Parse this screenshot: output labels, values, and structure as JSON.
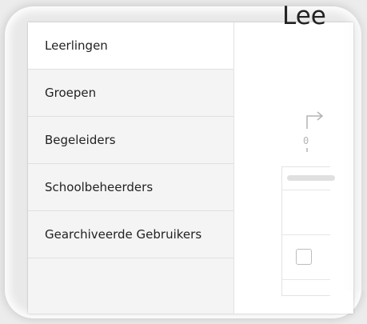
{
  "sidebar": {
    "items": [
      {
        "label": "Leerlingen",
        "active": true
      },
      {
        "label": "Groepen",
        "active": false
      },
      {
        "label": "Begeleiders",
        "active": false
      },
      {
        "label": "Schoolbeheerders",
        "active": false
      },
      {
        "label": "Gearchiveerde Gebruikers",
        "active": false
      }
    ]
  },
  "main": {
    "title": "Lee"
  },
  "icons": {
    "sort": "sort-icon",
    "checkbox": "checkbox"
  }
}
